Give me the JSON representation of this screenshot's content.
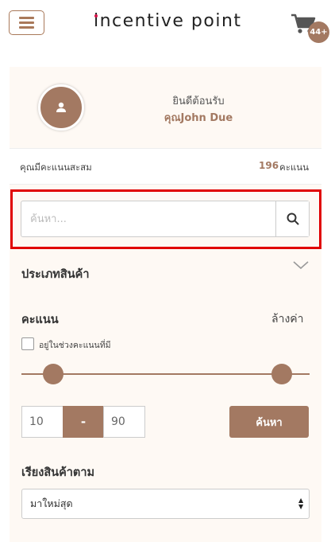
{
  "header": {
    "menu_icon": "hamburger-icon",
    "logo_text": "incentive point",
    "cart_icon": "shopping-cart-icon",
    "cart_badge": "44+"
  },
  "profile": {
    "avatar_icon": "user-icon",
    "welcome": "ยินดีต้อนรับ",
    "username": "คุณJohn Due"
  },
  "points": {
    "label": "คุณมีคะแนนสะสม",
    "value": "196",
    "unit": "คะแนน"
  },
  "search": {
    "placeholder": "ค้นหา...",
    "value": "",
    "button_icon": "search-icon"
  },
  "filters": {
    "category_title": "ประเภทสินค้า",
    "category_chevron": "chevron-down-icon",
    "points_title": "คะแนน",
    "clear_label": "ล้างค่า",
    "in_range_label": "อยู่ในช่วงคะแนนที่มี",
    "range_min": "10",
    "range_sep": "-",
    "range_max": "90",
    "search_button": "ค้นหา",
    "sort_title": "เรียงสินค้าตาม",
    "sort_selected": "มาใหม่สุด"
  },
  "colors": {
    "accent": "#a37962",
    "highlight_border": "#e00000",
    "brand_dot": "#d8134a"
  }
}
